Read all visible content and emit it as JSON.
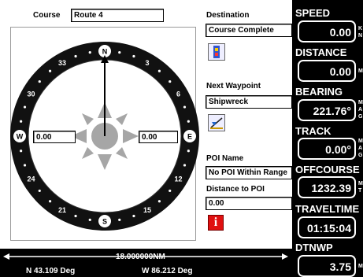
{
  "course": {
    "label": "Course",
    "value": "Route 4"
  },
  "compass": {
    "heading_labels": [
      "N",
      "3",
      "6",
      "E",
      "12",
      "15",
      "S",
      "21",
      "24",
      "W",
      "30",
      "33"
    ],
    "left_readout": "0.00",
    "right_readout": "0.00"
  },
  "destination": {
    "label": "Destination",
    "value": "Course Complete"
  },
  "next_waypoint": {
    "label": "Next Waypoint",
    "value": "Shipwreck"
  },
  "poi": {
    "name_label": "POI Name",
    "name_value": "No POI Within Range",
    "distance_label": "Distance to POI",
    "distance_value": "0.00"
  },
  "scale": {
    "value": "18.000000NM"
  },
  "position": {
    "lat": "N  43.109 Deg",
    "lon": "W  86.212 Deg"
  },
  "gauges": [
    {
      "title": "SPEED",
      "value": "0.00",
      "unit_lines": [
        "K",
        "N"
      ]
    },
    {
      "title": "DISTANCE",
      "value": "0.00",
      "unit_lines": [
        "M"
      ]
    },
    {
      "title": "BEARING",
      "value": "221.76°",
      "unit_lines": [
        "M",
        "A",
        "G"
      ]
    },
    {
      "title": "TRACK",
      "value": "0.00°",
      "unit_lines": [
        "M",
        "A",
        "G"
      ]
    },
    {
      "title": "OFFCOURSE",
      "value": "1232.39",
      "unit_lines": [
        "M",
        "T"
      ]
    },
    {
      "title": "TRAVELTIME",
      "value": "01:15:04",
      "unit_lines": []
    },
    {
      "title": "DTNWP",
      "value": "3.75",
      "unit_lines": [
        "M"
      ]
    }
  ],
  "colors": {
    "panel_bg": "#000000",
    "info_icon": "#e01010",
    "compass_rose": "#a6a6a6"
  }
}
